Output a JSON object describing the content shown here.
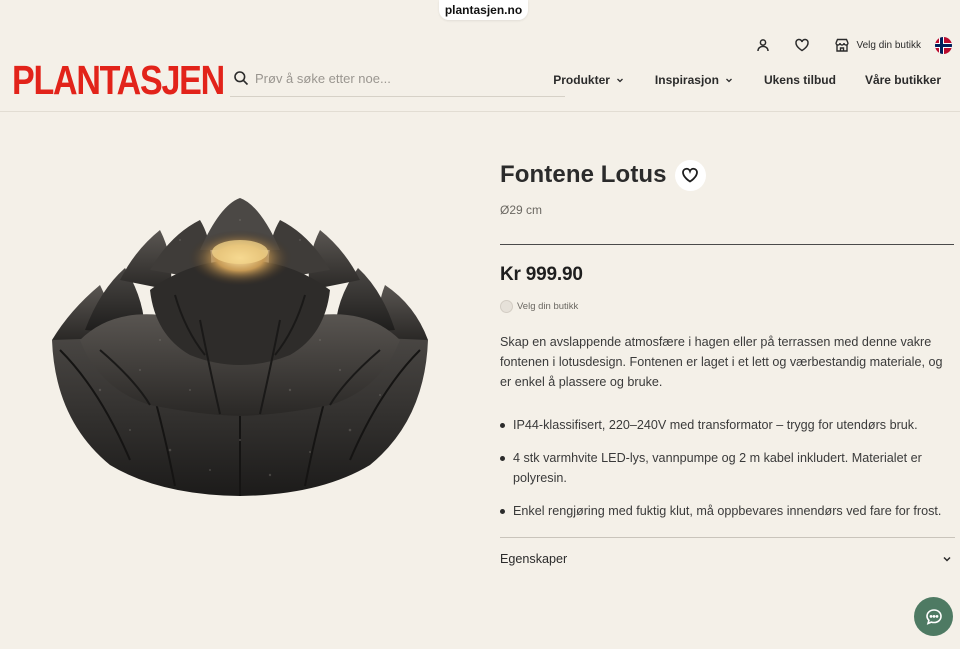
{
  "browser": {
    "url": "plantasjen.no"
  },
  "header": {
    "logo": "PLANTASJEN",
    "search_placeholder": "Prøv å søke etter noe...",
    "store_label": "Velg din butikk",
    "nav": [
      {
        "label": "Produkter",
        "has_dropdown": true
      },
      {
        "label": "Inspirasjon",
        "has_dropdown": true
      },
      {
        "label": "Ukens tilbud",
        "has_dropdown": false
      },
      {
        "label": "Våre butikker",
        "has_dropdown": false
      }
    ],
    "icons": [
      "user-icon",
      "heart-icon",
      "store-icon",
      "norway-flag-icon"
    ]
  },
  "product": {
    "title": "Fontene Lotus",
    "size": "Ø29 cm",
    "price": "Kr 999.90",
    "store_status": "Velg din butikk",
    "description": "Skap en avslappende atmosfære i hagen eller på terrassen med denne vakre fontenen i lotusdesign. Fontenen er laget i et lett og værbestandig materiale, og er enkel å plassere og bruke.",
    "bullets": [
      "IP44-klassifisert, 220–240V med transformator – trygg for utendørs bruk.",
      "4 stk varmhvite LED-lys, vannpumpe og 2 m kabel inkludert. Materialet er polyresin.",
      "Enkel rengjøring med fuktig klut, må oppbevares innendørs ved fare for frost."
    ],
    "accordion_label": "Egenskaper"
  },
  "colors": {
    "background": "#f4f0e8",
    "brand_red": "#e2231a",
    "chat_green": "#4e7a63"
  }
}
